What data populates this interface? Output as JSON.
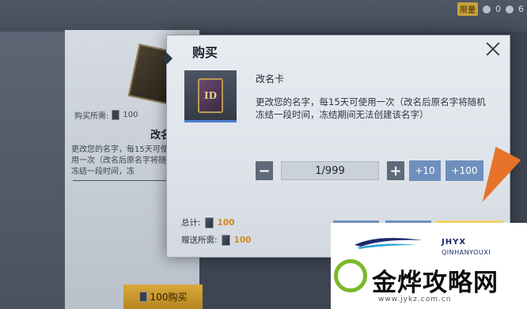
{
  "background": {
    "top_bar": {
      "vip_badge": "限量",
      "currency_1": "0",
      "currency_2": "6"
    },
    "item_panel": {
      "cost_label": "购买所需:",
      "cost_value": "100",
      "item_name": "改名",
      "description": "更改您的名字，每15天可使用一次（改名后原名字将随机冻结一段时间，冻",
      "buy_button_label": "100购买"
    }
  },
  "dialog": {
    "title": "购买",
    "item": {
      "card_text": "ID",
      "name": "改名卡",
      "description": "更改您的名字，每15天可使用一次（改名后原名字将随机冻结一段时间，冻结期间无法创建该名字）"
    },
    "quantity": {
      "minus_label": "−",
      "value": "1/999",
      "plus_label": "+",
      "plus10_label": "+10",
      "plus100_label": "+100"
    },
    "total": {
      "label": "总计:",
      "value": "100"
    },
    "gift": {
      "label": "赠送所需:",
      "value": "100"
    }
  },
  "watermark": {
    "brand": "JHYX",
    "brand_sub": "QINHANYOUXI",
    "main_text": "金烨攻略网",
    "url": "www.jykz.com.cn"
  },
  "colors": {
    "accent_blue": "#6f8fbd",
    "gold": "#d7ad36",
    "amount_orange": "#d08a1a",
    "arrow_orange": "#e7732a",
    "watermark_green": "#79b929"
  }
}
